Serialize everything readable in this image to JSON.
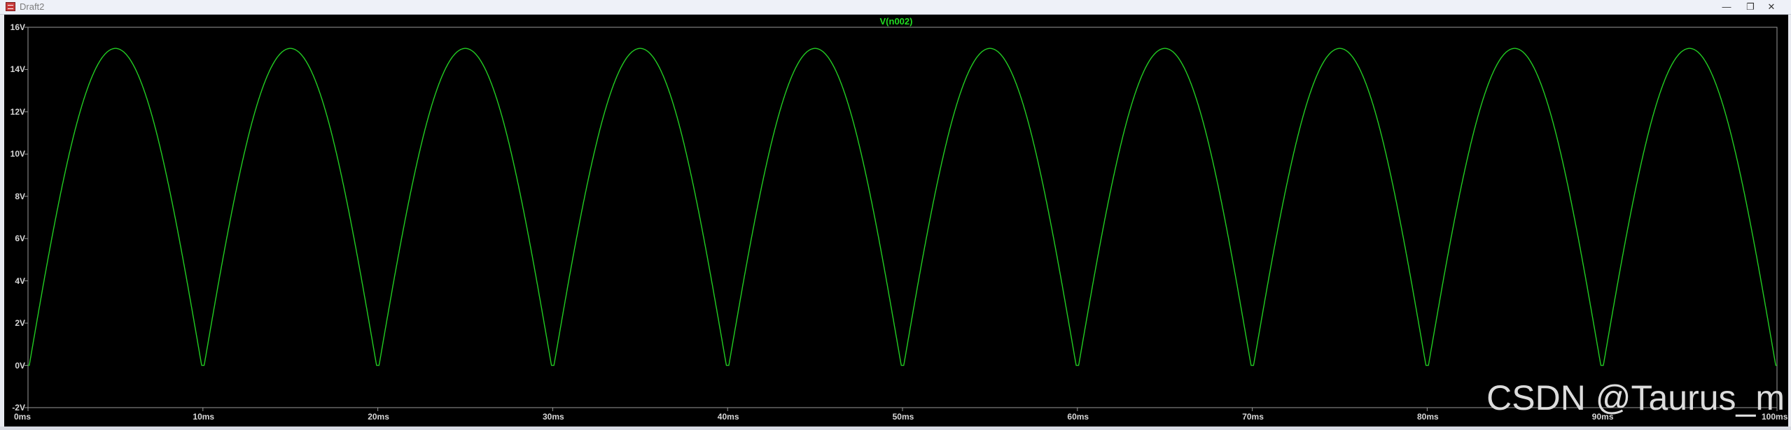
{
  "window": {
    "title": "Draft2",
    "controls": {
      "minimize": "—",
      "restore": "❐",
      "close": "✕"
    }
  },
  "plot": {
    "background": "#000000",
    "trace_color": "#22cc22",
    "watermark": "CSDN @Taurus_m"
  },
  "chart_data": {
    "type": "line",
    "title": "V(n002)",
    "xlabel": "",
    "ylabel": "",
    "xlim": [
      0,
      100
    ],
    "ylim": [
      -2,
      16
    ],
    "x_unit": "ms",
    "y_unit": "V",
    "y_ticks": [
      "-2V",
      "0V",
      "2V",
      "4V",
      "6V",
      "8V",
      "10V",
      "12V",
      "14V",
      "16V"
    ],
    "x_ticks": [
      "0ms",
      "10ms",
      "20ms",
      "30ms",
      "40ms",
      "50ms",
      "60ms",
      "70ms",
      "80ms",
      "90ms",
      "100ms"
    ],
    "series": [
      {
        "name": "V(n002)",
        "amplitude": 15.35,
        "period_ms": 10,
        "floor": 0,
        "form": "full-wave rectified sine"
      }
    ],
    "grid": false,
    "legend": "top-center"
  }
}
